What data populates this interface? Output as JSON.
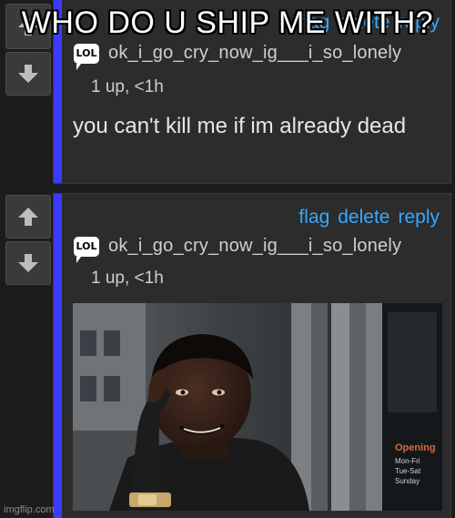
{
  "meme": {
    "caption": "WHO DO U SHIP ME WITH?",
    "watermark": "imgflip.com"
  },
  "comments": [
    {
      "actions": [
        "flag",
        "delete",
        "reply"
      ],
      "badge": "LOL",
      "username": "ok_i_go_cry_now_ig___i_so_lonely",
      "meta": "1 up, <1h",
      "body": "you can't kill me if im already dead"
    },
    {
      "actions": [
        "flag",
        "delete",
        "reply"
      ],
      "badge": "LOL",
      "username": "ok_i_go_cry_now_ig___i_so_lonely",
      "meta": "1 up, <1h",
      "image_sign": "Opening Mon-Fri Tue-Sat Sunday"
    }
  ],
  "colors": {
    "accent": "#3b3bff",
    "link": "#35a9ff",
    "background": "#1c1c1c",
    "card": "#2c2c2c"
  },
  "icons": [
    "arrow-up-icon",
    "arrow-down-icon",
    "lol-badge-icon"
  ]
}
